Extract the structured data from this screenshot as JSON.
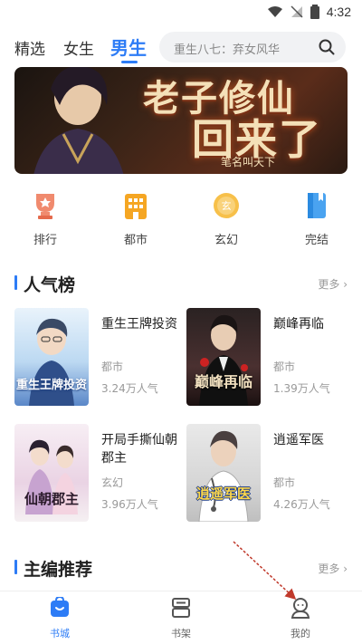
{
  "status_bar": {
    "time": "4:32"
  },
  "top_nav": {
    "tabs": [
      {
        "label": "精选"
      },
      {
        "label": "女生"
      },
      {
        "label": "男生"
      }
    ],
    "active_tab": "男生",
    "search_placeholder": "重生八七：弃女风华"
  },
  "banner": {
    "title_line1": "老子修仙",
    "title_line2": "回来了",
    "author": "笔名叫天下"
  },
  "categories": [
    {
      "label": "排行",
      "icon": "trophy-icon"
    },
    {
      "label": "都市",
      "icon": "city-icon"
    },
    {
      "label": "玄幻",
      "icon": "fantasy-icon"
    },
    {
      "label": "完结",
      "icon": "book-icon"
    }
  ],
  "popular": {
    "title": "人气榜",
    "more": "更多",
    "books": [
      {
        "title": "重生王牌投资",
        "genre": "都市",
        "popularity": "3.24万人气",
        "cover_text": "重生王牌投资"
      },
      {
        "title": "巅峰再临",
        "genre": "都市",
        "popularity": "1.39万人气",
        "cover_text": "巅峰再临"
      },
      {
        "title": "开局手撕仙朝郡主",
        "genre": "玄幻",
        "popularity": "3.96万人气",
        "cover_text": "仙朝郡主"
      },
      {
        "title": "逍遥军医",
        "genre": "都市",
        "popularity": "4.26万人气",
        "cover_text": "逍遥军医"
      }
    ]
  },
  "editor_picks": {
    "title": "主编推荐",
    "more": "更多"
  },
  "bottom_nav": {
    "items": [
      {
        "label": "书城",
        "icon": "bookstore-icon",
        "active": true
      },
      {
        "label": "书架",
        "icon": "bookshelf-icon",
        "active": false
      },
      {
        "label": "我的",
        "icon": "profile-icon",
        "active": false
      }
    ]
  },
  "colors": {
    "accent": "#2d7cf6",
    "arrow": "#c0392b"
  }
}
